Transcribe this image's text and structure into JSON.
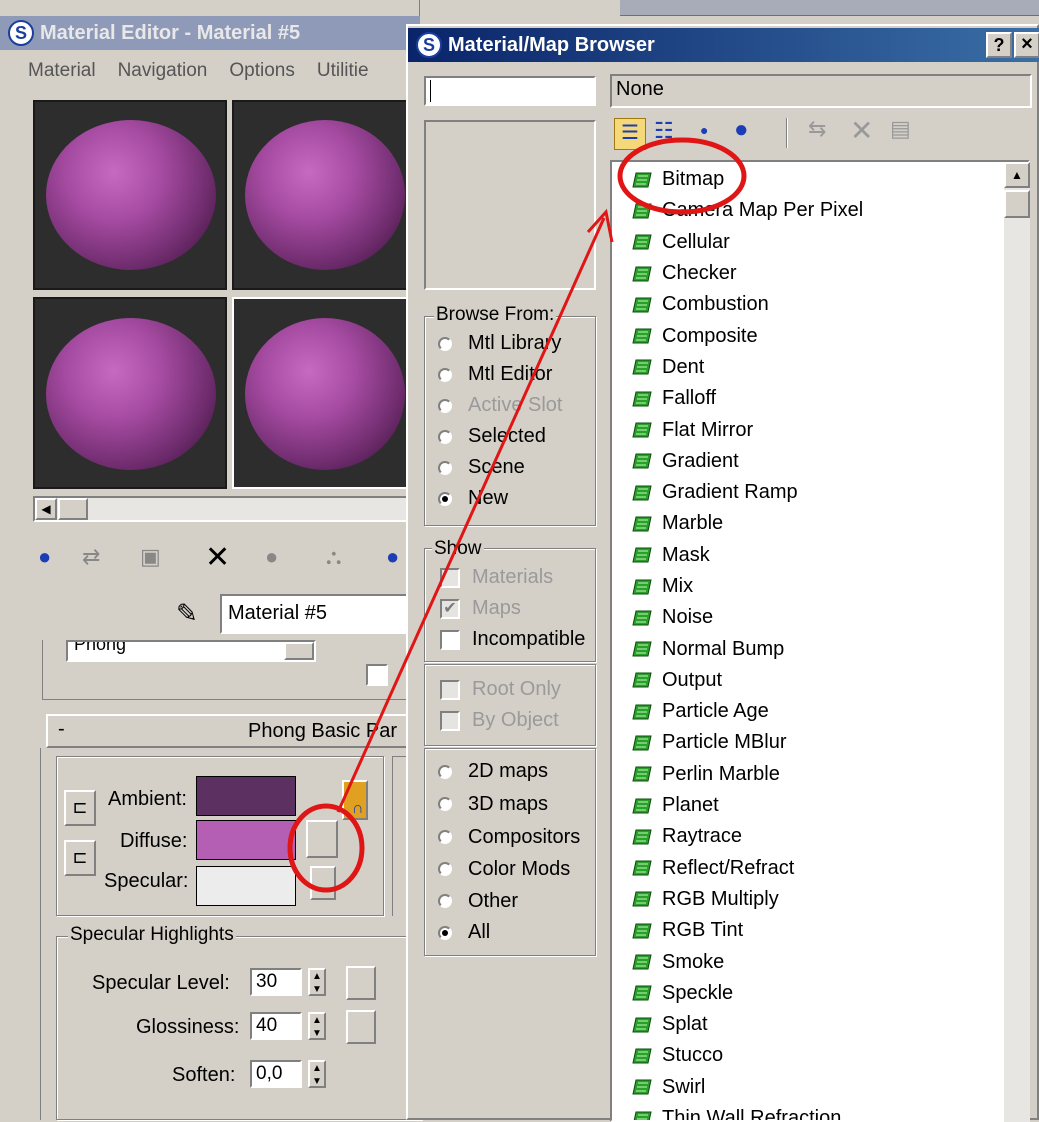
{
  "material_editor": {
    "title": "Material Editor - Material #5",
    "menu": [
      "Material",
      "Navigation",
      "Options",
      "Utilitie"
    ],
    "material_name": "Material #5",
    "shader_value": "Phong",
    "rollout_minus": "-",
    "rollout_title": "Phong Basic Par",
    "ambient_label": "Ambient:",
    "diffuse_label": "Diffuse:",
    "specular_label": "Specular:",
    "ambient_color": "#5c3060",
    "diffuse_color": "#b45eb4",
    "specular_color": "#ececec",
    "highlights_label": "Specular Highlights",
    "specular_level_label": "Specular Level:",
    "specular_level_value": "30",
    "glossiness_label": "Glossiness:",
    "glossiness_value": "40",
    "soften_label": "Soften:",
    "soften_value": "0,0"
  },
  "browser": {
    "title": "Material/Map Browser",
    "help_button": "?",
    "close_button": "×",
    "search_value": "",
    "current_value": "None",
    "browse_from_label": "Browse From:",
    "browse_from": [
      {
        "label": "Mtl Library",
        "selected": false,
        "disabled": false
      },
      {
        "label": "Mtl Editor",
        "selected": false,
        "disabled": false
      },
      {
        "label": "Active Slot",
        "selected": false,
        "disabled": true
      },
      {
        "label": "Selected",
        "selected": false,
        "disabled": false
      },
      {
        "label": "Scene",
        "selected": false,
        "disabled": false
      },
      {
        "label": "New",
        "selected": true,
        "disabled": false
      }
    ],
    "show_label": "Show",
    "show": [
      {
        "label": "Materials",
        "checked": false,
        "disabled": true
      },
      {
        "label": "Maps",
        "checked": true,
        "disabled": true
      },
      {
        "label": "Incompatible",
        "checked": false,
        "disabled": false
      }
    ],
    "options": [
      {
        "label": "Root Only",
        "checked": false
      },
      {
        "label": "By Object",
        "checked": false
      }
    ],
    "map_types": [
      {
        "label": "2D maps",
        "selected": false
      },
      {
        "label": "3D maps",
        "selected": false
      },
      {
        "label": "Compositors",
        "selected": false
      },
      {
        "label": "Color Mods",
        "selected": false
      },
      {
        "label": "Other",
        "selected": false
      },
      {
        "label": "All",
        "selected": true
      }
    ],
    "map_list": [
      "Bitmap",
      "Camera Map Per Pixel",
      "Cellular",
      "Checker",
      "Combustion",
      "Composite",
      "Dent",
      "Falloff",
      "Flat Mirror",
      "Gradient",
      "Gradient Ramp",
      "Marble",
      "Mask",
      "Mix",
      "Noise",
      "Normal Bump",
      "Output",
      "Particle Age",
      "Particle MBlur",
      "Perlin Marble",
      "Planet",
      "Raytrace",
      "Reflect/Refract",
      "RGB Multiply",
      "RGB Tint",
      "Smoke",
      "Speckle",
      "Splat",
      "Stucco",
      "Swirl",
      "Thin Wall Refraction"
    ]
  },
  "annotation_color": "#e01515"
}
